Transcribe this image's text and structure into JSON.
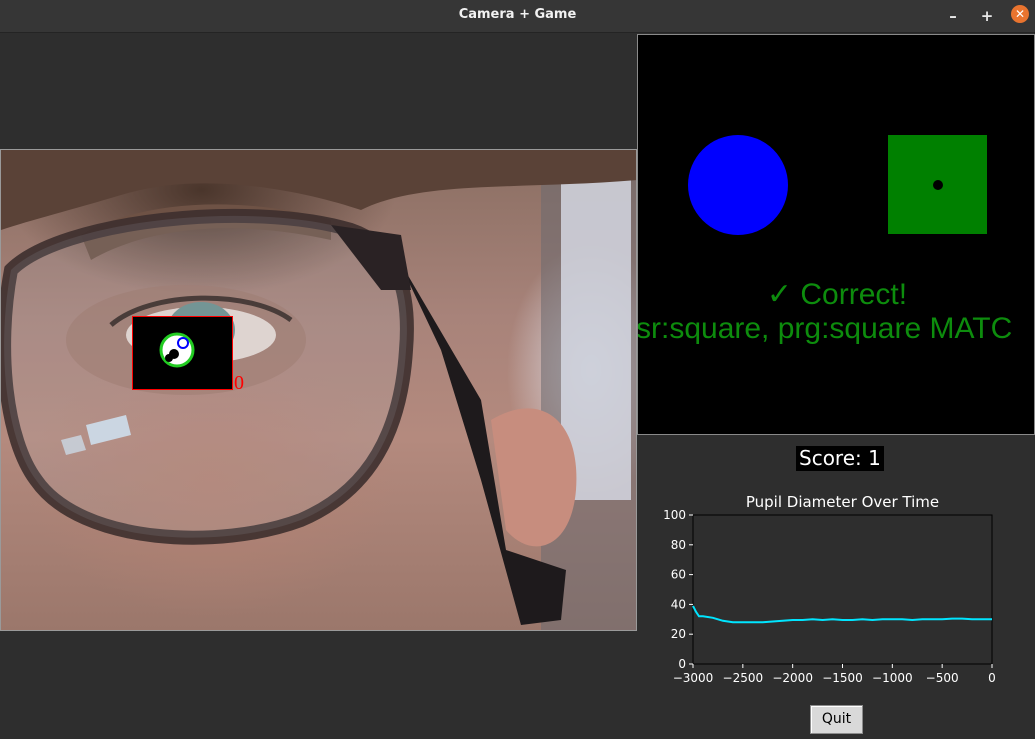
{
  "window": {
    "title": "Camera + Game",
    "min_icon": "minus-icon",
    "max_icon": "plus-icon",
    "close_icon": "close-icon"
  },
  "camera": {
    "blink_counter": "0"
  },
  "game": {
    "circle_color": "#0000ff",
    "square_color": "#008000",
    "feedback_line1": "✓ Correct!",
    "feedback_line2": "sr:square, prg:square MATC",
    "feedback_color": "#0d8c0d"
  },
  "score": {
    "label": "Score: 1"
  },
  "chart_data": {
    "type": "line",
    "title": "Pupil Diameter Over Time",
    "xlabel": "",
    "ylabel": "",
    "xlim": [
      -3000,
      0
    ],
    "ylim": [
      0,
      100
    ],
    "xticks": [
      -3000,
      -2500,
      -2000,
      -1500,
      -1000,
      -500,
      0
    ],
    "xtick_labels": [
      "−3000",
      "−2500",
      "−2000",
      "−1500",
      "−1000",
      "−500",
      "0"
    ],
    "yticks": [
      0,
      20,
      40,
      60,
      80,
      100
    ],
    "grid": false,
    "series": [
      {
        "color": "#00e5ff",
        "x": [
          -3000,
          -2970,
          -2940,
          -2900,
          -2800,
          -2700,
          -2600,
          -2500,
          -2400,
          -2300,
          -2200,
          -2100,
          -2000,
          -1900,
          -1800,
          -1700,
          -1600,
          -1500,
          -1400,
          -1300,
          -1200,
          -1100,
          -1000,
          -900,
          -800,
          -700,
          -600,
          -500,
          -400,
          -300,
          -200,
          -100,
          0
        ],
        "y": [
          39,
          35,
          32,
          32,
          31,
          29,
          28,
          28,
          28,
          28,
          28.5,
          29,
          29.5,
          29.5,
          30,
          29.5,
          30,
          29.5,
          29.5,
          30,
          29.5,
          30,
          30,
          30,
          29.5,
          30,
          30,
          30,
          30.5,
          30.5,
          30,
          30,
          30
        ]
      }
    ]
  },
  "quit": {
    "label": "Quit"
  }
}
